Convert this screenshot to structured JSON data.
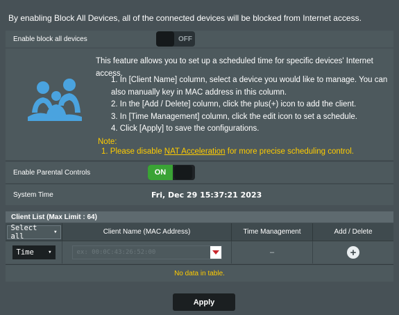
{
  "top_message": "By enabling Block All Devices, all of the connected devices will be blocked from Internet access.",
  "block_all": {
    "label": "Enable block all devices",
    "state": "OFF"
  },
  "info": {
    "intro": "This feature allows you to set up a scheduled time for specific devices' Internet access.",
    "steps": [
      "1. In [Client Name] column, select a device you would like to manage. You can also manually key in MAC address in this column.",
      "2. In the [Add / Delete] column, click the plus(+) icon to add the client.",
      "3. In [Time Management] column, click the edit icon to set a schedule.",
      "4. Click [Apply] to save the configurations."
    ],
    "note_label": "Note:",
    "note_prefix": "1. Please disable ",
    "note_link": "NAT Acceleration",
    "note_suffix": " for more precise scheduling control."
  },
  "parental": {
    "label": "Enable Parental Controls",
    "state": "ON"
  },
  "system_time": {
    "label": "System Time",
    "value": "Fri, Dec 29 15:37:21 2023"
  },
  "client_list": {
    "title": "Client List (Max Limit : 64)",
    "headers": {
      "select": "Select all",
      "client_name": "Client Name (MAC Address)",
      "time_management": "Time Management",
      "add_delete": "Add / Delete"
    },
    "input_row": {
      "mode": "Time",
      "mac_placeholder": "ex: 00:0C:43:26:52:00",
      "time_management": "–"
    },
    "empty_message": "No data in table."
  },
  "apply_label": "Apply",
  "colors": {
    "background": "#475156",
    "panel": "#4d595d",
    "note": "#ffcc00",
    "toggle_on": "#3aa335",
    "icon_blue": "#4aa3df"
  }
}
